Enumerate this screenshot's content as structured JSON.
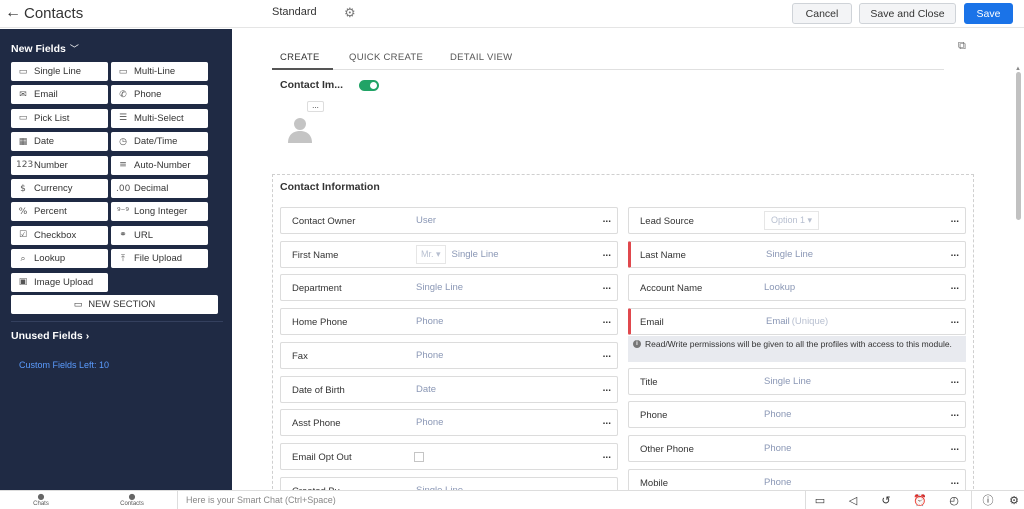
{
  "header": {
    "back_glyph": "←",
    "title": "Contacts",
    "layout_name": "Standard",
    "cancel": "Cancel",
    "save_close": "Save and Close",
    "save": "Save",
    "save_color": "#1a73e8"
  },
  "sidebar": {
    "new_fields": "New Fields",
    "tiles": [
      {
        "label": "Single Line",
        "icon": "single-line-icon",
        "glyph": "▭"
      },
      {
        "label": "Multi-Line",
        "icon": "multi-line-icon",
        "glyph": "▭"
      },
      {
        "label": "Email",
        "icon": "email-icon",
        "glyph": "✉"
      },
      {
        "label": "Phone",
        "icon": "phone-icon",
        "glyph": "✆"
      },
      {
        "label": "Pick List",
        "icon": "pick-list-icon",
        "glyph": "▭"
      },
      {
        "label": "Multi-Select",
        "icon": "multi-select-icon",
        "glyph": "☰"
      },
      {
        "label": "Date",
        "icon": "date-icon",
        "glyph": "▦"
      },
      {
        "label": "Date/Time",
        "icon": "date-time-icon",
        "glyph": "◷"
      },
      {
        "label": "Number",
        "icon": "number-icon",
        "glyph": "123"
      },
      {
        "label": "Auto-Number",
        "icon": "auto-number-icon",
        "glyph": "≡"
      },
      {
        "label": "Currency",
        "icon": "currency-icon",
        "glyph": "$"
      },
      {
        "label": "Decimal",
        "icon": "decimal-icon",
        "glyph": ".00"
      },
      {
        "label": "Percent",
        "icon": "percent-icon",
        "glyph": "%"
      },
      {
        "label": "Long Integer",
        "icon": "long-integer-icon",
        "glyph": "⁹⁻⁹"
      },
      {
        "label": "Checkbox",
        "icon": "checkbox-icon",
        "glyph": "☑"
      },
      {
        "label": "URL",
        "icon": "url-icon",
        "glyph": "⚭"
      },
      {
        "label": "Lookup",
        "icon": "lookup-icon",
        "glyph": "⌕"
      },
      {
        "label": "File Upload",
        "icon": "file-upload-icon",
        "glyph": "⤒"
      },
      {
        "label": "Image Upload",
        "icon": "image-upload-icon",
        "glyph": "▣"
      }
    ],
    "new_section": "NEW SECTION",
    "unused_fields": "Unused Fields",
    "custom_fields_left": "Custom Fields Left: 10"
  },
  "tabs": [
    {
      "label": "CREATE",
      "active": true
    },
    {
      "label": "QUICK CREATE",
      "active": false
    },
    {
      "label": "DETAIL VIEW",
      "active": false
    }
  ],
  "image_field": {
    "label": "Contact Im...",
    "toggle_on": true,
    "toggle_color": "#21a366",
    "more": "..."
  },
  "section": {
    "title": "Contact Information",
    "left": [
      {
        "label": "Contact Owner",
        "value": "User",
        "type": "plain"
      },
      {
        "label": "First Name",
        "value": "Single Line",
        "type": "salutation",
        "salutation": "Mr. ▾"
      },
      {
        "label": "Department",
        "value": "Single Line",
        "type": "plain"
      },
      {
        "label": "Home Phone",
        "value": "Phone",
        "type": "plain"
      },
      {
        "label": "Fax",
        "value": "Phone",
        "type": "plain"
      },
      {
        "label": "Date of Birth",
        "value": "Date",
        "type": "plain"
      },
      {
        "label": "Asst Phone",
        "value": "Phone",
        "type": "plain"
      },
      {
        "label": "Email Opt Out",
        "value": "",
        "type": "checkbox"
      },
      {
        "label": "Created By",
        "value": "Single Line",
        "type": "plain"
      }
    ],
    "right": [
      {
        "label": "Lead Source",
        "value": "Option 1 ▾",
        "type": "select",
        "required": false
      },
      {
        "label": "Last Name",
        "value": "Single Line",
        "type": "plain",
        "required": true
      },
      {
        "label": "Account Name",
        "value": "Lookup",
        "type": "plain",
        "required": false
      },
      {
        "label": "Email",
        "value": "Email",
        "unique": "(Unique)",
        "type": "unique",
        "required": true
      },
      {
        "label": "Title",
        "value": "Single Line",
        "type": "plain",
        "required": false
      },
      {
        "label": "Phone",
        "value": "Phone",
        "type": "plain",
        "required": false
      },
      {
        "label": "Other Phone",
        "value": "Phone",
        "type": "plain",
        "required": false
      },
      {
        "label": "Mobile",
        "value": "Phone",
        "type": "plain",
        "required": false
      }
    ],
    "note": "Read/Write permissions will be given to all the profiles with access to this module.",
    "row_more": "...",
    "required_color": "#e0484d"
  },
  "bottombar": {
    "chats": "Chats",
    "contacts": "Contacts",
    "smart_chat_placeholder": "Here is your Smart Chat (Ctrl+Space)"
  }
}
